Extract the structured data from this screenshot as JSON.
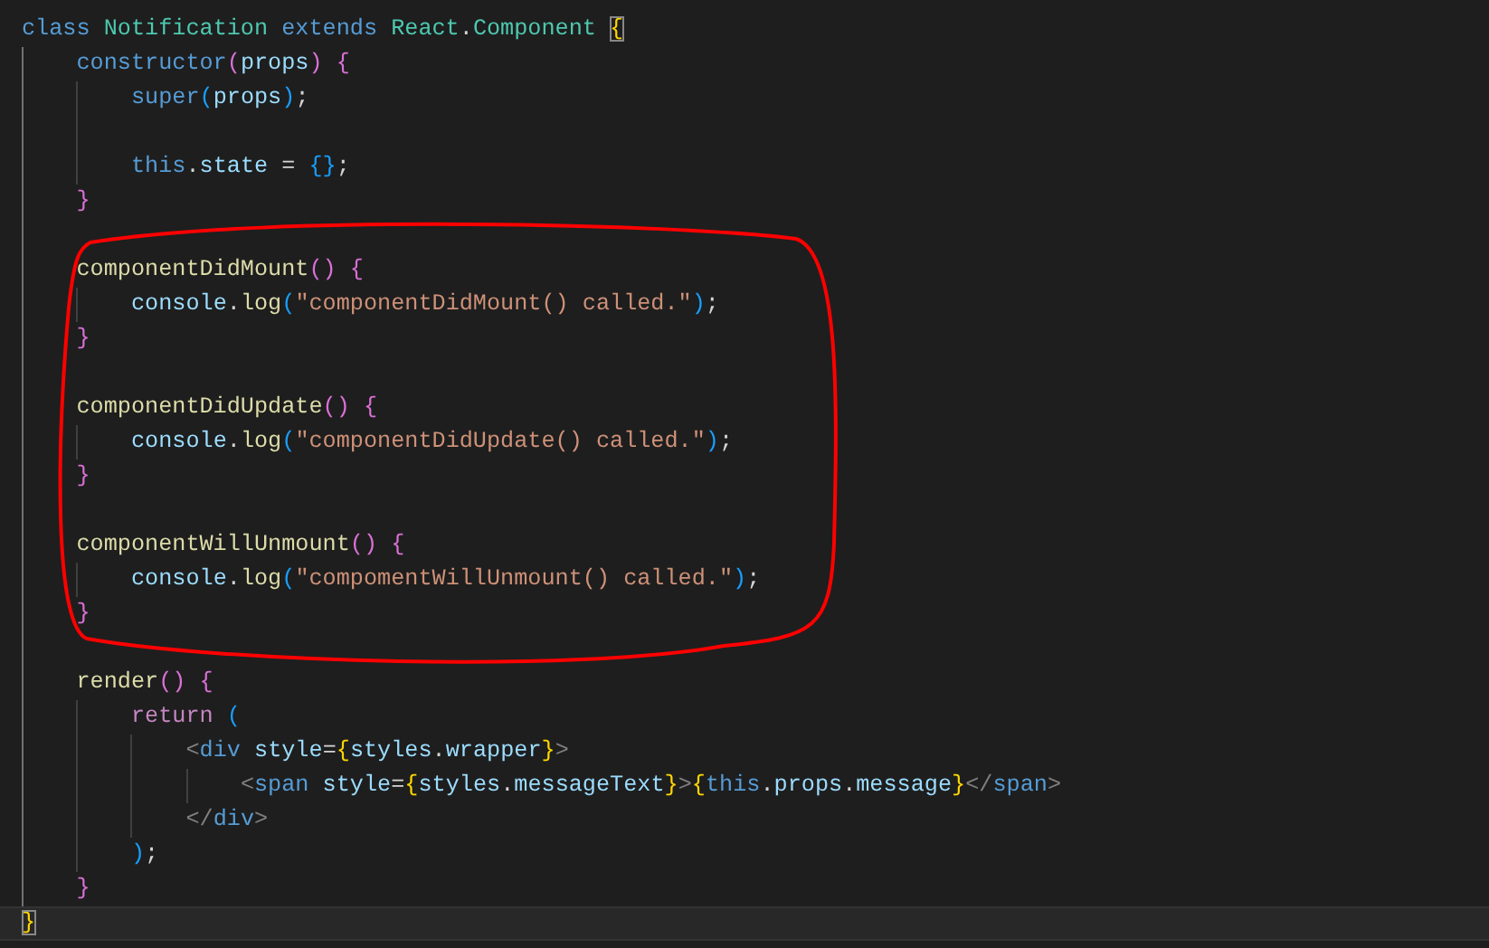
{
  "editor": {
    "lines": [
      {
        "current": false,
        "tokens": [
          {
            "kind": "kw",
            "text": "class"
          },
          {
            "kind": "cls",
            "text": " Notification"
          },
          {
            "kind": "kw",
            "text": " extends"
          },
          {
            "kind": "cls",
            "text": " React"
          },
          {
            "kind": "punct",
            "text": "."
          },
          {
            "kind": "cls",
            "text": "Component"
          },
          {
            "kind": "b1",
            "text": " {",
            "matched": true
          }
        ],
        "children": [
          {
            "current": false,
            "tokens": [
              {
                "kind": "kw",
                "text": "constructor"
              },
              {
                "kind": "b2",
                "text": "("
              },
              {
                "kind": "var",
                "text": "props"
              },
              {
                "kind": "b2",
                "text": ")"
              },
              {
                "kind": "b2",
                "text": " {"
              }
            ],
            "children": [
              {
                "current": false,
                "tokens": [
                  {
                    "kind": "kw",
                    "text": "super"
                  },
                  {
                    "kind": "b3",
                    "text": "("
                  },
                  {
                    "kind": "var",
                    "text": "props"
                  },
                  {
                    "kind": "b3",
                    "text": ")"
                  },
                  {
                    "kind": "punct",
                    "text": ";"
                  }
                ]
              },
              {
                "current": false
              },
              {
                "current": false,
                "tokens": [
                  {
                    "kind": "kw",
                    "text": "this"
                  },
                  {
                    "kind": "punct",
                    "text": "."
                  },
                  {
                    "kind": "var",
                    "text": "state"
                  },
                  {
                    "kind": "punct",
                    "text": " = "
                  },
                  {
                    "kind": "b3",
                    "text": "{}"
                  },
                  {
                    "kind": "punct",
                    "text": ";"
                  }
                ]
              }
            ]
          },
          {
            "current": false,
            "tokens": [
              {
                "kind": "b2",
                "text": "}"
              }
            ]
          },
          {
            "current": false
          },
          {
            "current": false,
            "tokens": [
              {
                "kind": "fn",
                "text": "componentDidMount"
              },
              {
                "kind": "b2",
                "text": "()"
              },
              {
                "kind": "b2",
                "text": " {"
              }
            ],
            "children": [
              {
                "current": false,
                "tokens": [
                  {
                    "kind": "var",
                    "text": "console"
                  },
                  {
                    "kind": "punct",
                    "text": "."
                  },
                  {
                    "kind": "fn",
                    "text": "log"
                  },
                  {
                    "kind": "b3",
                    "text": "("
                  },
                  {
                    "kind": "str",
                    "text": "\"componentDidMount() called.\""
                  },
                  {
                    "kind": "b3",
                    "text": ")"
                  },
                  {
                    "kind": "punct",
                    "text": ";"
                  }
                ]
              }
            ]
          },
          {
            "current": false,
            "tokens": [
              {
                "kind": "b2",
                "text": "}"
              }
            ]
          },
          {
            "current": false
          },
          {
            "current": false,
            "tokens": [
              {
                "kind": "fn",
                "text": "componentDidUpdate"
              },
              {
                "kind": "b2",
                "text": "()"
              },
              {
                "kind": "b2",
                "text": " {"
              }
            ],
            "children": [
              {
                "current": false,
                "tokens": [
                  {
                    "kind": "var",
                    "text": "console"
                  },
                  {
                    "kind": "punct",
                    "text": "."
                  },
                  {
                    "kind": "fn",
                    "text": "log"
                  },
                  {
                    "kind": "b3",
                    "text": "("
                  },
                  {
                    "kind": "str",
                    "text": "\"componentDidUpdate() called.\""
                  },
                  {
                    "kind": "b3",
                    "text": ")"
                  },
                  {
                    "kind": "punct",
                    "text": ";"
                  }
                ]
              }
            ]
          },
          {
            "current": false,
            "tokens": [
              {
                "kind": "b2",
                "text": "}"
              }
            ]
          },
          {
            "current": false
          },
          {
            "current": false,
            "tokens": [
              {
                "kind": "fn",
                "text": "componentWillUnmount"
              },
              {
                "kind": "b2",
                "text": "()"
              },
              {
                "kind": "b2",
                "text": " {"
              }
            ],
            "children": [
              {
                "current": false,
                "tokens": [
                  {
                    "kind": "var",
                    "text": "console"
                  },
                  {
                    "kind": "punct",
                    "text": "."
                  },
                  {
                    "kind": "fn",
                    "text": "log"
                  },
                  {
                    "kind": "b3",
                    "text": "("
                  },
                  {
                    "kind": "str",
                    "text": "\"compomentWillUnmount() called.\""
                  },
                  {
                    "kind": "b3",
                    "text": ")"
                  },
                  {
                    "kind": "punct",
                    "text": ";"
                  }
                ]
              }
            ]
          },
          {
            "current": false,
            "tokens": [
              {
                "kind": "b2",
                "text": "}"
              }
            ]
          },
          {
            "current": false
          },
          {
            "current": false,
            "tokens": [
              {
                "kind": "fn",
                "text": "render"
              },
              {
                "kind": "b2",
                "text": "()"
              },
              {
                "kind": "b2",
                "text": " {"
              }
            ],
            "children": [
              {
                "current": false,
                "tokens": [
                  {
                    "kind": "ctrl",
                    "text": "return"
                  },
                  {
                    "kind": "b3",
                    "text": " ("
                  }
                ],
                "children": [
                  {
                    "current": false,
                    "tokens": [
                      {
                        "kind": "tag",
                        "text": "<"
                      },
                      {
                        "kind": "kw",
                        "text": "div"
                      },
                      {
                        "kind": "var",
                        "text": " style"
                      },
                      {
                        "kind": "punct",
                        "text": "="
                      },
                      {
                        "kind": "b1",
                        "text": "{"
                      },
                      {
                        "kind": "var",
                        "text": "styles"
                      },
                      {
                        "kind": "punct",
                        "text": "."
                      },
                      {
                        "kind": "var",
                        "text": "wrapper"
                      },
                      {
                        "kind": "b1",
                        "text": "}"
                      },
                      {
                        "kind": "tag",
                        "text": ">"
                      }
                    ],
                    "children": [
                      {
                        "current": false,
                        "tokens": [
                          {
                            "kind": "tag",
                            "text": "<"
                          },
                          {
                            "kind": "kw",
                            "text": "span"
                          },
                          {
                            "kind": "var",
                            "text": " style"
                          },
                          {
                            "kind": "punct",
                            "text": "="
                          },
                          {
                            "kind": "b1",
                            "text": "{"
                          },
                          {
                            "kind": "var",
                            "text": "styles"
                          },
                          {
                            "kind": "punct",
                            "text": "."
                          },
                          {
                            "kind": "var",
                            "text": "messageText"
                          },
                          {
                            "kind": "b1",
                            "text": "}"
                          },
                          {
                            "kind": "tag",
                            "text": ">"
                          },
                          {
                            "kind": "b1",
                            "text": "{"
                          },
                          {
                            "kind": "kw",
                            "text": "this"
                          },
                          {
                            "kind": "punct",
                            "text": "."
                          },
                          {
                            "kind": "var",
                            "text": "props"
                          },
                          {
                            "kind": "punct",
                            "text": "."
                          },
                          {
                            "kind": "var",
                            "text": "message"
                          },
                          {
                            "kind": "b1",
                            "text": "}"
                          },
                          {
                            "kind": "tag",
                            "text": "</"
                          },
                          {
                            "kind": "kw",
                            "text": "span"
                          },
                          {
                            "kind": "tag",
                            "text": ">"
                          }
                        ]
                      }
                    ]
                  },
                  {
                    "current": false,
                    "tokens": [
                      {
                        "kind": "tag",
                        "text": "</"
                      },
                      {
                        "kind": "kw",
                        "text": "div"
                      },
                      {
                        "kind": "tag",
                        "text": ">"
                      }
                    ]
                  }
                ]
              },
              {
                "current": false,
                "tokens": [
                  {
                    "kind": "b3",
                    "text": ")"
                  },
                  {
                    "kind": "punct",
                    "text": ";"
                  }
                ]
              }
            ]
          },
          {
            "current": false,
            "tokens": [
              {
                "kind": "b2",
                "text": "}"
              }
            ]
          }
        ]
      },
      {
        "current": true,
        "tokens": [
          {
            "kind": "b1",
            "text": "}",
            "matched": true
          }
        ]
      }
    ]
  },
  "annotations": [
    {
      "kind": "outline"
    }
  ]
}
